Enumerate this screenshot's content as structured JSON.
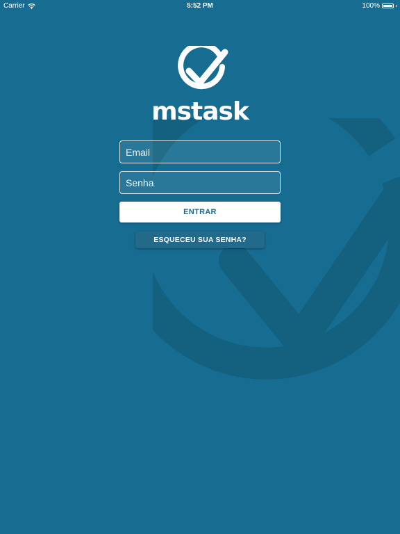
{
  "status_bar": {
    "carrier": "Carrier",
    "time": "5:52 PM",
    "battery": "100%"
  },
  "brand": {
    "name": "mstask"
  },
  "login": {
    "email_placeholder": "Email",
    "password_placeholder": "Senha",
    "submit_label": "ENTRAR",
    "forgot_label": "ESQUECEU SUA SENHA?"
  },
  "icons": {
    "wifi": "wifi-icon",
    "battery": "battery-icon",
    "logo": "check-circle-icon",
    "watermark": "check-circle-watermark-icon"
  },
  "colors": {
    "background": "#176d91",
    "watermark": "#13607f",
    "button_text": "#176d91",
    "secondary_button": "#22698a"
  }
}
